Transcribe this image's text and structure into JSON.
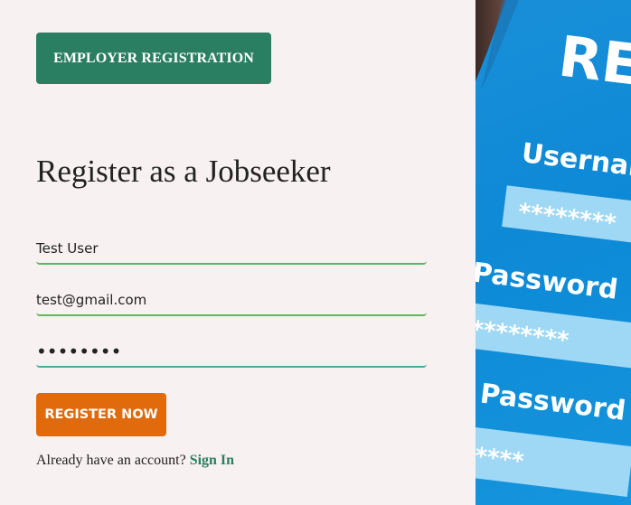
{
  "header": {
    "employer_button_label": "EMPLOYER REGISTRATION"
  },
  "form": {
    "title": "Register as a Jobseeker",
    "name_value": "Test User",
    "email_value": "test@gmail.com",
    "password_value": "••••••••",
    "register_button_label": "REGISTER NOW",
    "signin_prompt": "Already have an account?",
    "signin_link_label": "Sign In"
  },
  "hero_image": {
    "title_fragment": "REG",
    "username_label": "Username",
    "username_mask": "********",
    "password_label": "Password",
    "password_mask": "********",
    "confirm_label": "- Password",
    "confirm_mask": "******"
  },
  "colors": {
    "primary_green": "#2a7f62",
    "accent_orange": "#e06a0c",
    "background": "#f8f1f1",
    "hero_blue": "#0d89d6"
  }
}
